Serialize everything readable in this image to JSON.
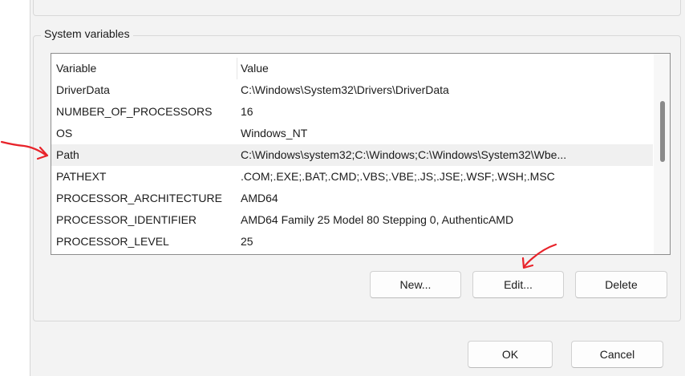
{
  "system_variables": {
    "group_title": "System variables",
    "columns": {
      "variable": "Variable",
      "value": "Value"
    },
    "rows": [
      {
        "variable": "DriverData",
        "value": "C:\\Windows\\System32\\Drivers\\DriverData"
      },
      {
        "variable": "NUMBER_OF_PROCESSORS",
        "value": "16"
      },
      {
        "variable": "OS",
        "value": "Windows_NT"
      },
      {
        "variable": "Path",
        "value": "C:\\Windows\\system32;C:\\Windows;C:\\Windows\\System32\\Wbe..."
      },
      {
        "variable": "PATHEXT",
        "value": ".COM;.EXE;.BAT;.CMD;.VBS;.VBE;.JS;.JSE;.WSF;.WSH;.MSC"
      },
      {
        "variable": "PROCESSOR_ARCHITECTURE",
        "value": "AMD64"
      },
      {
        "variable": "PROCESSOR_IDENTIFIER",
        "value": "AMD64 Family 25 Model 80 Stepping 0, AuthenticAMD"
      },
      {
        "variable": "PROCESSOR_LEVEL",
        "value": "25"
      }
    ],
    "selected_variable": "Path",
    "buttons": {
      "new": "New...",
      "edit": "Edit...",
      "delete": "Delete"
    }
  },
  "dialog_buttons": {
    "ok": "OK",
    "cancel": "Cancel"
  },
  "colors": {
    "annotation_arrow": "#e8232a",
    "selected_row": "#f0f0f0",
    "panel_background": "#f3f3f3"
  }
}
